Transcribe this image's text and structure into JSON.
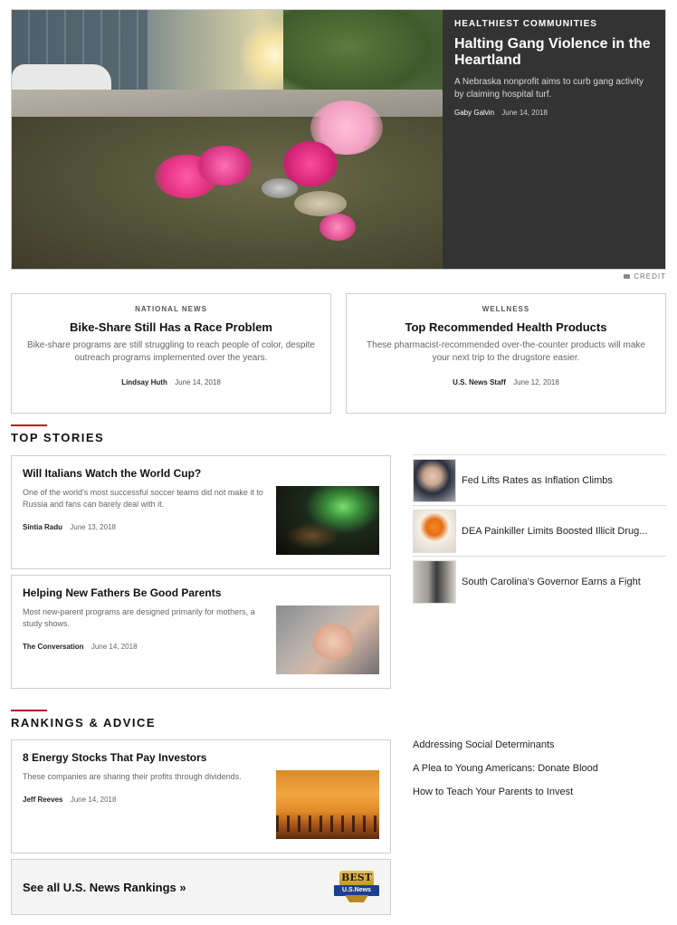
{
  "hero": {
    "kicker": "HEALTHIEST COMMUNITIES",
    "title": "Halting Gang Violence in the Heartland",
    "dek": "A Nebraska nonprofit aims to curb gang activity by claiming hospital turf.",
    "author": "Gaby Galvin",
    "date": "June 14, 2018",
    "credit": "CREDIT"
  },
  "feature_cards": [
    {
      "kicker": "NATIONAL NEWS",
      "title": "Bike-Share Still Has a Race Problem",
      "dek": "Bike-share programs are still struggling to reach people of color, despite outreach programs implemented over the years.",
      "author": "Lindsay Huth",
      "date": "June 14, 2018"
    },
    {
      "kicker": "WELLNESS",
      "title": "Top Recommended Health Products",
      "dek": "These pharmacist-recommended over-the-counter products will make your next trip to the drugstore easier.",
      "author": "U.S. News Staff",
      "date": "June 12, 2018"
    }
  ],
  "top_stories": {
    "heading": "TOP STORIES",
    "cards": [
      {
        "title": "Will Italians Watch the World Cup?",
        "dek": "One of the world's most successful soccer teams did not make it to Russia and fans can barely deal with it.",
        "author": "Sintia Radu",
        "date": "June 13, 2018"
      },
      {
        "title": "Helping New Fathers Be Good Parents",
        "dek": "Most new-parent programs are designed primarily for mothers, a study shows.",
        "author": "The Conversation",
        "date": "June 14, 2018"
      }
    ],
    "side": [
      "Fed Lifts Rates as Inflation Climbs",
      "DEA Painkiller Limits Boosted Illicit Drug...",
      "South Carolina's Governor Earns a Fight"
    ]
  },
  "rankings": {
    "heading": "RANKINGS & ADVICE",
    "card": {
      "title": "8 Energy Stocks That Pay Investors",
      "dek": "These companies are sharing their profits through dividends.",
      "author": "Jeff Reeves",
      "date": "June 14, 2018"
    },
    "links": [
      "Addressing Social Determinants",
      "A Plea to Young Americans: Donate Blood",
      "How to Teach Your Parents to Invest"
    ],
    "see_all": "See all U.S. News Rankings »",
    "badge_top": "BEST",
    "badge_ribbon": "U.S.News"
  }
}
